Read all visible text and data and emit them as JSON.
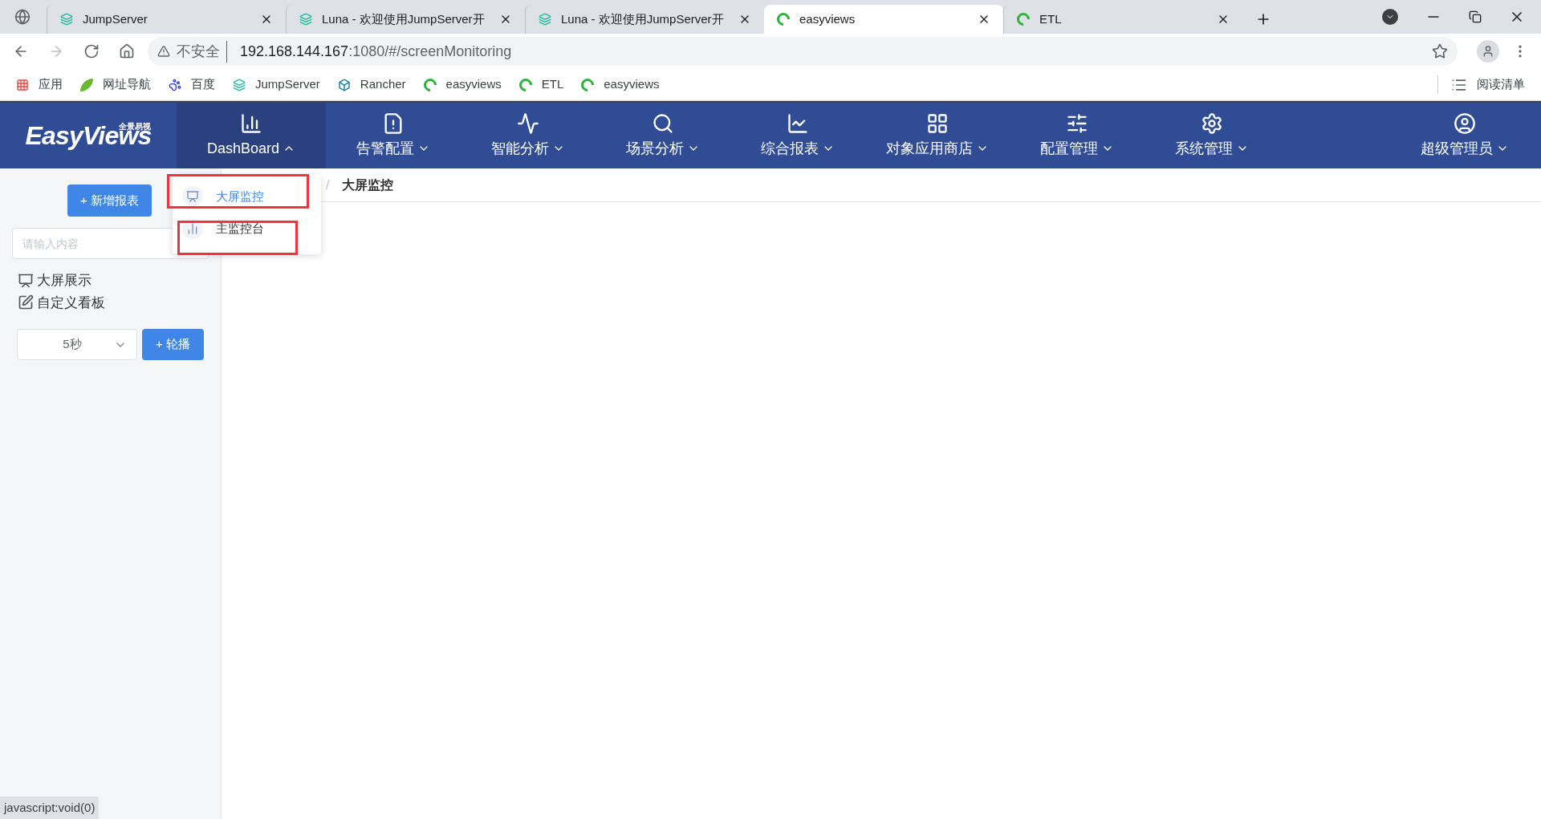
{
  "browser": {
    "tabs": [
      {
        "title": "JumpServer",
        "kind": "jump",
        "selected": false
      },
      {
        "title": "Luna - 欢迎使用JumpServer开",
        "kind": "jump",
        "selected": false
      },
      {
        "title": "Luna - 欢迎使用JumpServer开",
        "kind": "jump",
        "selected": false
      },
      {
        "title": "easyviews",
        "kind": "ev",
        "selected": true
      },
      {
        "title": "ETL",
        "kind": "ev",
        "selected": false
      }
    ],
    "security": "不安全",
    "url_host": "192.168.144.167",
    "url_rest": ":1080/#/screenMonitoring",
    "bookmarks": [
      {
        "label": "应用",
        "kind": "apps"
      },
      {
        "label": "网址导航",
        "kind": "hao"
      },
      {
        "label": "百度",
        "kind": "baidu"
      },
      {
        "label": "JumpServer",
        "kind": "jump"
      },
      {
        "label": "Rancher",
        "kind": "rancher"
      },
      {
        "label": "easyviews",
        "kind": "ev"
      },
      {
        "label": "ETL",
        "kind": "ev"
      },
      {
        "label": "easyviews",
        "kind": "ev"
      }
    ],
    "reading_list": "阅读清单"
  },
  "app": {
    "logo": "EasyViews",
    "logo_tag": "全景易视",
    "nav": [
      {
        "label": "DashBoard",
        "selected": true,
        "expanded": true
      },
      {
        "label": "告警配置",
        "selected": false,
        "expanded": false
      },
      {
        "label": "智能分析",
        "selected": false,
        "expanded": false
      },
      {
        "label": "场景分析",
        "selected": false,
        "expanded": false
      },
      {
        "label": "综合报表",
        "selected": false,
        "expanded": false
      },
      {
        "label": "对象应用商店",
        "selected": false,
        "expanded": false
      },
      {
        "label": "配置管理",
        "selected": false,
        "expanded": false
      },
      {
        "label": "系统管理",
        "selected": false,
        "expanded": false
      }
    ],
    "user": "超级管理员",
    "dropdown": [
      {
        "label": "大屏监控",
        "selected": true,
        "kind": "screen"
      },
      {
        "label": "主监控台",
        "selected": false,
        "kind": "bars"
      }
    ],
    "breadcrumb": {
      "separator": "/",
      "current": "大屏监控"
    },
    "sidebar": {
      "add_button": "+ 新增报表",
      "search": {
        "placeholder": "请输入内容"
      },
      "items": [
        {
          "label": "大屏展示",
          "kind": "screen"
        },
        {
          "label": "自定义看板",
          "kind": "edit"
        }
      ],
      "interval": "5秒",
      "carousel_button": "+ 轮播"
    }
  },
  "status_bar": "javascript:void(0)"
}
